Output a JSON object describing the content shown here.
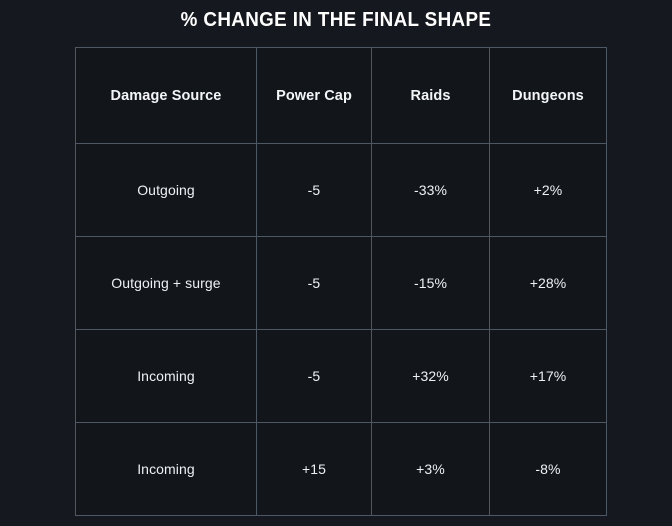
{
  "page": {
    "title": "% CHANGE IN THE FINAL SHAPE",
    "background_color": "#15181e",
    "cell_background_color": "#12161b",
    "border_color": "#5f6a76",
    "text_color": "#f3f5f7"
  },
  "chart_data": {
    "type": "table",
    "title": "% CHANGE IN THE FINAL SHAPE",
    "columns": [
      "Damage Source",
      "Power Cap",
      "Raids",
      "Dungeons"
    ],
    "rows": [
      {
        "source": "Outgoing",
        "power_cap": "-5",
        "raids": "-33%",
        "dungeons": "+2%"
      },
      {
        "source": "Outgoing + surge",
        "power_cap": "-5",
        "raids": "-15%",
        "dungeons": "+28%"
      },
      {
        "source": "Incoming",
        "power_cap": "-5",
        "raids": "+32%",
        "dungeons": "+17%"
      },
      {
        "source": "Incoming",
        "power_cap": "+15",
        "raids": "+3%",
        "dungeons": "-8%"
      }
    ],
    "values": {
      "power_cap": [
        -5,
        -5,
        -5,
        15
      ],
      "raids": [
        -33,
        -15,
        32,
        3
      ],
      "dungeons": [
        2,
        28,
        17,
        -8
      ]
    },
    "units": {
      "power_cap": "levels",
      "raids": "percent",
      "dungeons": "percent"
    }
  }
}
